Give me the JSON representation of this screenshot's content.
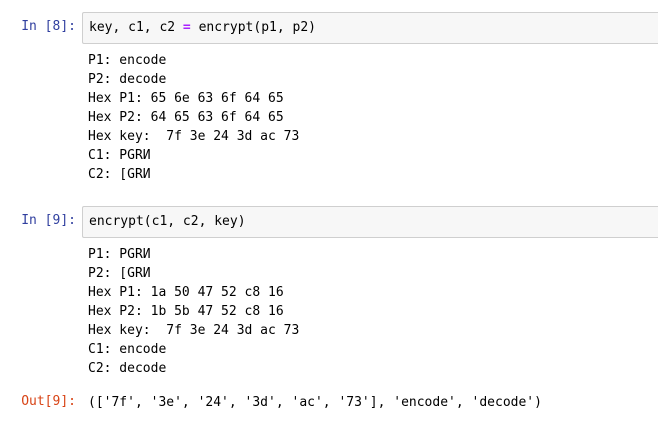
{
  "cells": [
    {
      "prompt": "In [8]:",
      "code": {
        "lhs": "key, c1, c2",
        "op": "=",
        "rhs": "encrypt(p1, p2)"
      },
      "output_lines": [
        "P1: encode",
        "P2: decode",
        "Hex P1: 65 6e 63 6f 64 65",
        "Hex P2: 64 65 63 6f 64 65",
        "Hex key:  7f 3e 24 3d ac 73",
        "C1: \u001aPGRИ\u0016",
        "C2: \u001b[GRИ\u0016"
      ]
    },
    {
      "prompt": "In [9]:",
      "code": {
        "full": "encrypt(c1, c2, key)"
      },
      "output_lines": [
        "P1: \u001aPGRИ\u0016",
        "P2: \u001b[GRИ\u0016",
        "Hex P1: 1a 50 47 52 c8 16",
        "Hex P2: 1b 5b 47 52 c8 16",
        "Hex key:  7f 3e 24 3d ac 73",
        "C1: encode",
        "C2: decode"
      ],
      "out_prompt": "Out[9]:",
      "out_value": "(['7f', '3e', '24', '3d', 'ac', '73'], 'encode', 'decode')"
    }
  ]
}
